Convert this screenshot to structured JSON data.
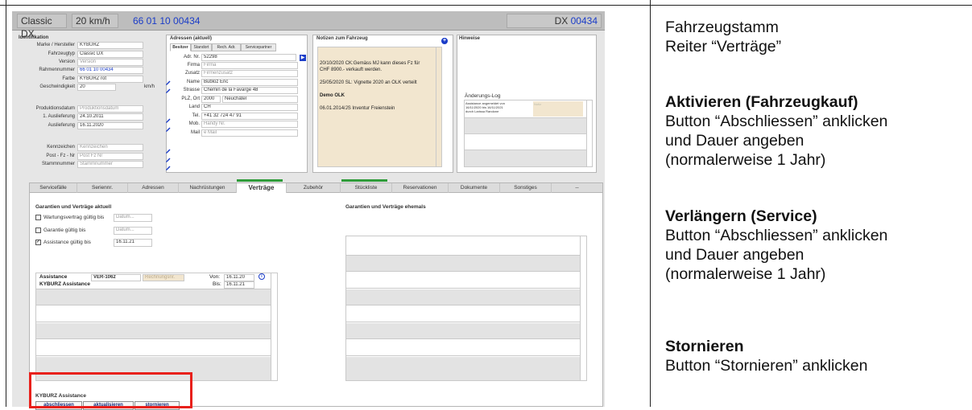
{
  "header": {
    "model": "Classic DX",
    "speed": "20",
    "speed_unit": "km/h",
    "frame_number": "66 01 10 00434",
    "dx_prefix": "DX",
    "dx_number": "00434"
  },
  "identification": {
    "title": "Identifikation",
    "fields": [
      {
        "label": "Marke / Hersteller",
        "value": "KYBURZ",
        "placeholder": false
      },
      {
        "label": "Fahrzeugtyp",
        "value": "Classic DX",
        "placeholder": false
      },
      {
        "label": "Version",
        "value": "Version",
        "placeholder": true
      },
      {
        "label": "Rahmennummer",
        "value": "66 01 10 00434",
        "placeholder": false
      },
      {
        "label": "Farbe",
        "value": "KYBURZ rot",
        "placeholder": false
      },
      {
        "label": "Geschwindigkeit",
        "value": "20",
        "unit": "km/h",
        "placeholder": false
      },
      {
        "label": "Produktionsdatum",
        "value": "Produktionsdatum",
        "placeholder": true
      },
      {
        "label": "1. Auslieferung",
        "value": "24.10.2011",
        "placeholder": false
      },
      {
        "label": "Auslieferung",
        "value": "16.11.2020",
        "placeholder": false
      },
      {
        "label": "Kennzeichen",
        "value": "Kennzeichen",
        "placeholder": true
      },
      {
        "label": "Post - Fz - Nr",
        "value": "Post Fz Nr",
        "placeholder": true
      },
      {
        "label": "Stammnummer",
        "value": "Stammnummer",
        "placeholder": true
      }
    ]
  },
  "addresses": {
    "title": "Adressen (aktuell)",
    "tabs": [
      "Besitzer",
      "Standort",
      "Rech. Adr.",
      "Servicepartner"
    ],
    "fields": [
      {
        "label": "Adr. Nr.",
        "value": "52298",
        "placeholder": false
      },
      {
        "label": "Firma",
        "value": "Firma",
        "placeholder": true
      },
      {
        "label": "Zusatz",
        "value": "Firmenzusatz",
        "placeholder": true
      },
      {
        "label": "Name",
        "value": "Bubloz Eric",
        "placeholder": false
      },
      {
        "label": "Strasse",
        "value": "Chemin de la Favarge 48",
        "placeholder": false
      },
      {
        "label": "PLZ, Ort",
        "value": "2000",
        "value2": "Neuchâtel",
        "placeholder": false
      },
      {
        "label": "Land",
        "value": "CH",
        "placeholder": false
      },
      {
        "label": "Tel.",
        "value": "+41 32 724 47 91",
        "placeholder": false
      },
      {
        "label": "Mob.",
        "value": "Handy Nr.",
        "placeholder": true
      },
      {
        "label": "Mail",
        "value": "e Mail",
        "placeholder": true
      }
    ]
  },
  "notes": {
    "title": "Notizen zum Fahrzeug",
    "lines": [
      "20/10/2020 CK:Gemäss MJ kann dieses Fz für",
      "CHF 8900.- verkauft werden.",
      "25/05/2020 SL: Vignette 2020 an OLK verteilt",
      "Demo OLK",
      "06.01.2014/JS Inventur Freienstein"
    ]
  },
  "hints": {
    "title": "Hinweise",
    "log_title": "Änderungs-Log",
    "log_entry_1": "Assistance angemeldet von",
    "log_entry_2": "16/11/2020 bis 16/11/2021",
    "log_entry_3": "durch Larissa Randone",
    "log_side": "Notiz"
  },
  "main_tabs": [
    "Servicefälle",
    "Seriennr.",
    "Adressen",
    "Nachrüstungen",
    "Verträge",
    "Zubehör",
    "Stückliste",
    "Reservationen",
    "Dokumente",
    "Sonstiges",
    "--"
  ],
  "active_tab": "Verträge",
  "contracts": {
    "current_title": "Garantien und Verträge aktuell",
    "former_title": "Garantien und Verträge ehemals",
    "rows": [
      {
        "label": "Wartungsvertrag gültig bis",
        "value": "Datum...",
        "checked": false,
        "placeholder": true
      },
      {
        "label": "Garantie gültig bis",
        "value": "Datum...",
        "checked": false,
        "placeholder": true
      },
      {
        "label": "Assistance gültig bis",
        "value": "16.11.21",
        "checked": true,
        "placeholder": false
      }
    ],
    "selected": {
      "type": "Assistance",
      "number": "VER-1062",
      "invoice_placeholder": "Rechnungsnr.",
      "from_label": "Von:",
      "from": "16.11.20",
      "to_label": "Bis:",
      "to": "16.11.21",
      "name": "KYBURZ Assistance"
    },
    "footer_title": "KYBURZ Assistance",
    "buttons": {
      "close": "abschliessen",
      "update": "aktualisieren",
      "cancel": "stornieren"
    }
  },
  "instructions": {
    "line1": "Fahrzeugstamm",
    "line2": "Reiter “Verträge”",
    "activate_title": "Aktivieren (Fahrzeugkauf)",
    "activate_1": "Button “Abschliessen” anklicken",
    "activate_2": "und Dauer angeben",
    "activate_3": "(normalerweise 1 Jahr)",
    "extend_title": "Verlängern (Service)",
    "extend_1": "Button “Abschliessen” anklicken",
    "extend_2": "und Dauer angeben",
    "extend_3": "(normalerweise 1 Jahr)",
    "cancel_title": "Stornieren",
    "cancel_1": "Button “Stornieren” anklicken"
  },
  "colors": {
    "accent_blue": "#1a3cc8",
    "active_tab_green": "#2f9c3a",
    "highlight_red": "#e8201b",
    "note_background": "#f2e6cf"
  }
}
